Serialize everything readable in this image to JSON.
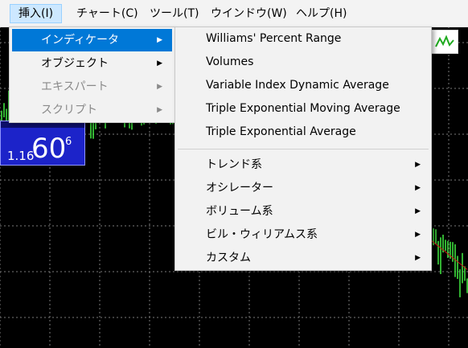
{
  "menubar": {
    "items": [
      {
        "label": "挿入(I)"
      },
      {
        "label": "チャート(C)"
      },
      {
        "label": "ツール(T)"
      },
      {
        "label": "ウインドウ(W)"
      },
      {
        "label": "ヘルプ(H)"
      }
    ]
  },
  "insert_menu": {
    "items": [
      {
        "label": "インディケータ",
        "state": "highlighted"
      },
      {
        "label": "オブジェクト",
        "state": "normal"
      },
      {
        "label": "エキスパート",
        "state": "disabled"
      },
      {
        "label": "スクリプト",
        "state": "disabled"
      }
    ]
  },
  "indicator_submenu": {
    "recent": [
      {
        "label": "Williams' Percent Range"
      },
      {
        "label": "Volumes"
      },
      {
        "label": "Variable Index Dynamic Average"
      },
      {
        "label": "Triple Exponential Moving Average"
      },
      {
        "label": "Triple Exponential Average"
      }
    ],
    "categories": [
      {
        "label": "トレンド系"
      },
      {
        "label": "オシレーター"
      },
      {
        "label": "ボリューム系"
      },
      {
        "label": "ビル・ウィリアムス系"
      },
      {
        "label": "カスタム"
      }
    ]
  },
  "price_box": {
    "small": "1.16",
    "big": "60",
    "sup": "6"
  },
  "chart": {
    "background": "#000000",
    "candle_color": "#3ee03e",
    "ma_color": "#cc1a1a",
    "grid_color": "#7a7a7a"
  },
  "icons": {
    "submenu_arrow": "▶",
    "toolbar_indicator": "indicator-wave-icon"
  }
}
